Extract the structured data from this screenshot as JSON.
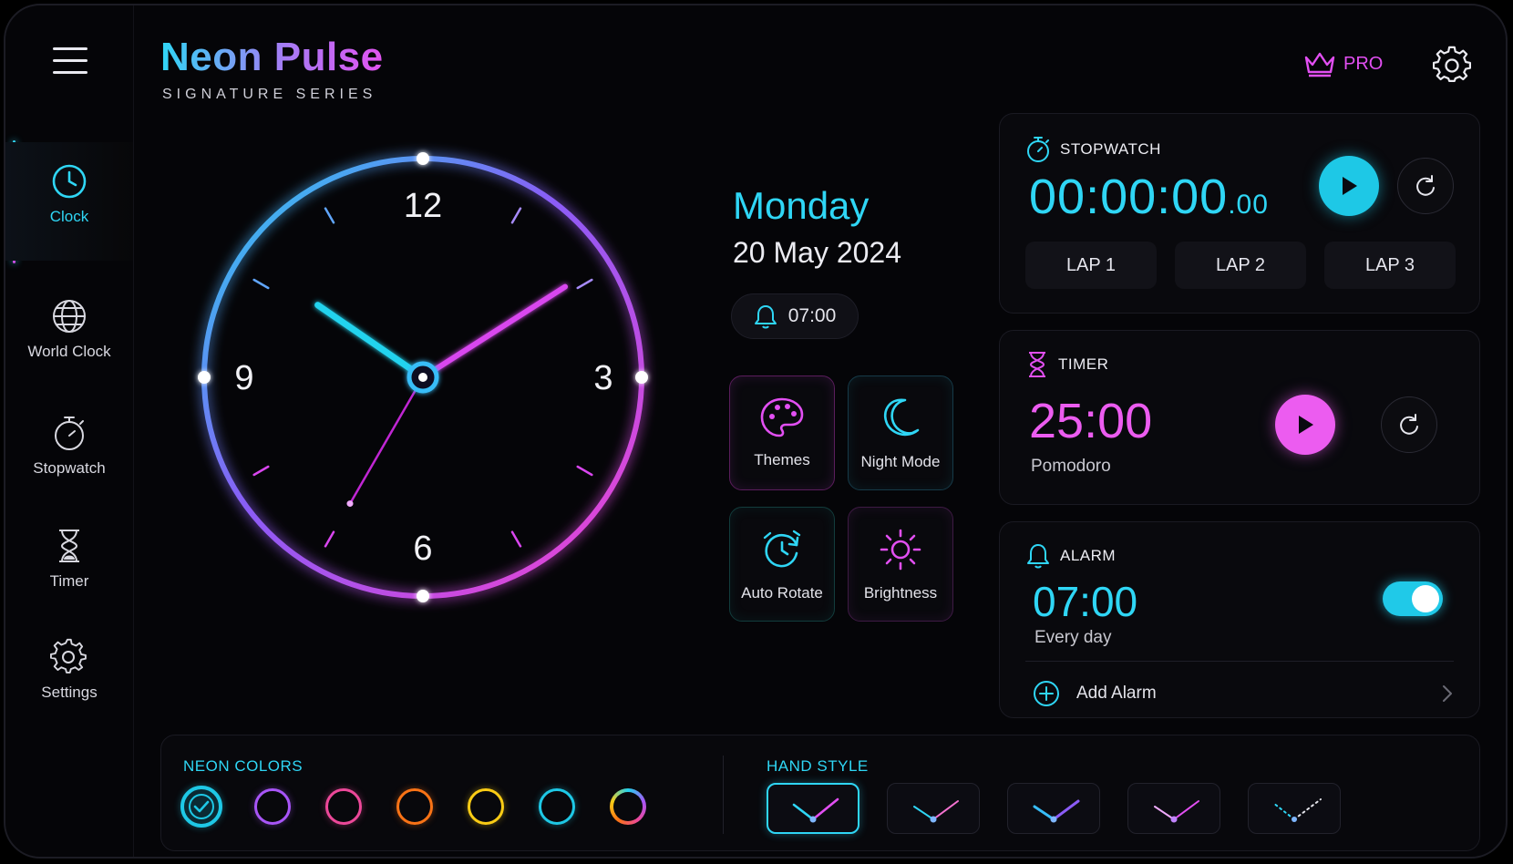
{
  "brand": {
    "title": "Neon Pulse",
    "subtitle": "SIGNATURE SERIES"
  },
  "header": {
    "pro_label": "PRO"
  },
  "sidebar": {
    "items": [
      {
        "label": "Clock",
        "icon": "clock-icon",
        "active": true
      },
      {
        "label": "World Clock",
        "icon": "globe-icon"
      },
      {
        "label": "Stopwatch",
        "icon": "stopwatch-icon"
      },
      {
        "label": "Timer",
        "icon": "hourglass-icon"
      },
      {
        "label": "Settings",
        "icon": "gear-icon"
      }
    ]
  },
  "clock": {
    "numerals": {
      "twelve": "12",
      "three": "3",
      "six": "6",
      "nine": "9"
    },
    "time": {
      "hours": 10,
      "minutes": 9,
      "seconds": 35
    }
  },
  "date": {
    "day": "Monday",
    "full": "20 May 2024"
  },
  "next_alarm": "07:00",
  "quick_tiles": [
    {
      "label": "Themes",
      "icon": "palette-icon"
    },
    {
      "label": "Night Mode",
      "icon": "moon-icon"
    },
    {
      "label": "Auto Rotate",
      "icon": "auto-rotate-icon"
    },
    {
      "label": "Brightness",
      "icon": "sun-icon"
    }
  ],
  "stopwatch": {
    "title": "STOPWATCH",
    "time_main": "00:00:00",
    "time_fraction": ".00",
    "laps": [
      "LAP 1",
      "LAP 2",
      "LAP 3"
    ]
  },
  "timer": {
    "title": "TIMER",
    "time": "25:00",
    "label": "Pomodoro"
  },
  "alarm": {
    "title": "ALARM",
    "time": "07:00",
    "repeat": "Every day",
    "enabled": true,
    "add_label": "Add Alarm"
  },
  "neon_colors": {
    "label": "NEON COLORS",
    "swatches": [
      "#1ec8e6",
      "#a855f7",
      "#ec4899",
      "#f97316",
      "#facc15",
      "#1ec8e6",
      "gradient"
    ],
    "selected_index": 0
  },
  "hand_style": {
    "label": "HAND STYLE",
    "selected_index": 0
  },
  "colors": {
    "accent_cyan": "#2fd6f5",
    "accent_magenta": "#e24ff2",
    "background": "#050508"
  }
}
